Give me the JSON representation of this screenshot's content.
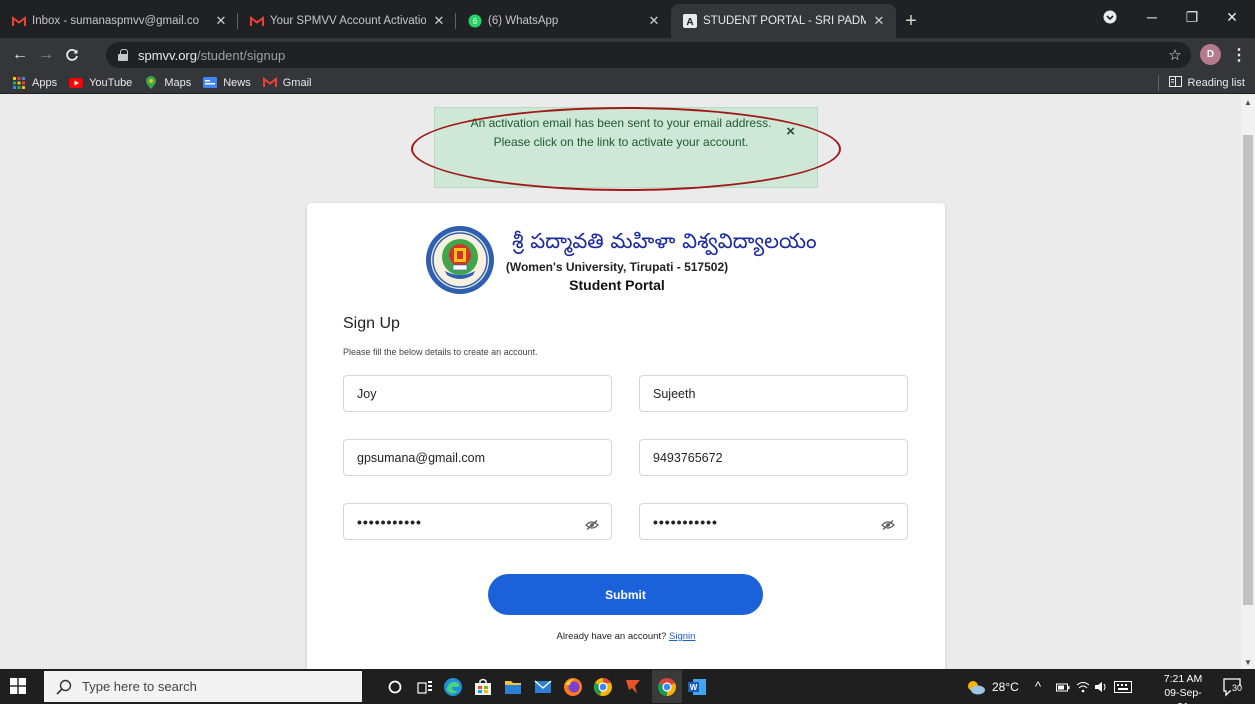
{
  "browser": {
    "tabs": [
      {
        "title": "Inbox - sumanaspmvv@gmail.co",
        "icon": "gmail-icon",
        "active": false
      },
      {
        "title": "Your SPMVV Account Activation",
        "icon": "gmail-icon",
        "active": false
      },
      {
        "title": "(6) WhatsApp",
        "icon": "whatsapp-icon",
        "active": false
      },
      {
        "title": "STUDENT PORTAL - SRI PADMAV",
        "icon": "portal-icon",
        "active": true
      }
    ],
    "new_tab": "+",
    "address": {
      "host": "spmvv.org",
      "path": "/student/signup"
    },
    "profile_initial": "D",
    "bookmarks": [
      {
        "label": "Apps",
        "icon": "apps-grid-icon"
      },
      {
        "label": "YouTube",
        "icon": "youtube-icon"
      },
      {
        "label": "Maps",
        "icon": "maps-icon"
      },
      {
        "label": "News",
        "icon": "news-icon"
      },
      {
        "label": "Gmail",
        "icon": "gmail-icon"
      }
    ],
    "reading_list": "Reading list"
  },
  "alert": {
    "message": "An activation email has been sent to your email address. Please click on the link to activate your account.",
    "close": "×"
  },
  "header": {
    "telugu_name": "శ్రీ పద్మావతి మహిళా విశ్వవిద్యాలయం",
    "subtitle": "(Women's University, Tirupati - 517502)",
    "portal": "Student Portal"
  },
  "form": {
    "title": "Sign Up",
    "hint": "Please fill the below details to create an account.",
    "first_name": "Joy",
    "last_name": "Sujeeth",
    "email": "gpsumana@gmail.com",
    "phone": "9493765672",
    "password": "•••••••••••",
    "confirm_password": "•••••••••••",
    "submit": "Submit",
    "signin_prompt": "Already have an account? ",
    "signin_link": "Signin"
  },
  "taskbar": {
    "search_placeholder": "Type here to search",
    "weather": "28°C",
    "time": "7:21 AM",
    "date": "09-Sep-21",
    "notifications": "30"
  }
}
